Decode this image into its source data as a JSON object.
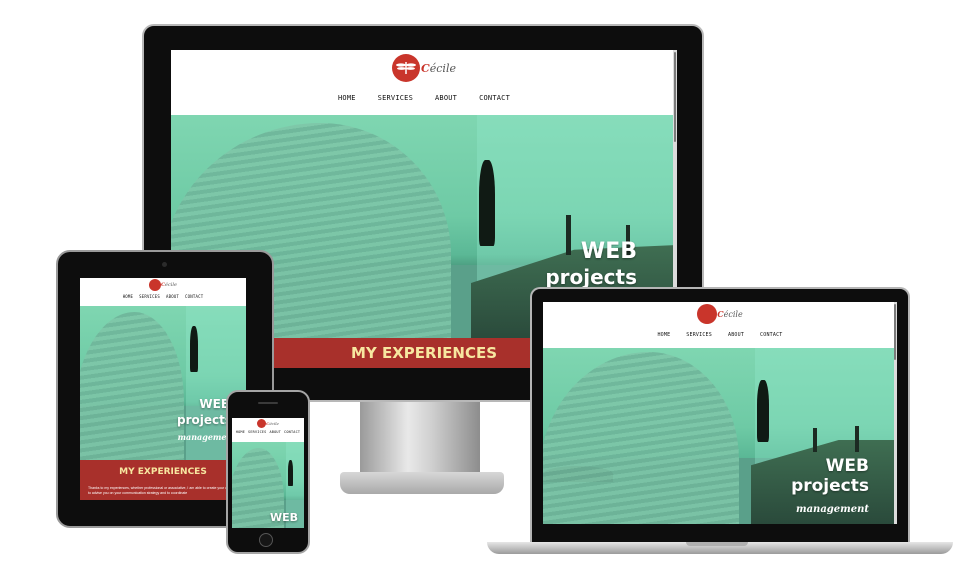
{
  "site": {
    "logo_initial": "C",
    "logo_rest": "écile",
    "nav": [
      "HOME",
      "SERVICES",
      "ABOUT",
      "CONTACT"
    ],
    "hero_word1": "WEB",
    "hero_word2": "projects",
    "hero_script": "management",
    "section_title": "MY EXPERIENCES",
    "intro_text": "Thanks to my experiences, whether professional or associative, I am able to create your website, to advise you on your communication strategy and to coordinate"
  },
  "devices": [
    "desktop-monitor",
    "tablet",
    "phone",
    "laptop"
  ],
  "colors": {
    "accent": "#c9352b",
    "band": "#a8302b",
    "band_text": "#f7e7a0",
    "hero": "#7fd6b1",
    "bezel": "#0d0d0d"
  },
  "icons": {
    "logo": "dragonfly-logo-icon",
    "camera": "camera-icon",
    "home": "home-button-icon"
  }
}
